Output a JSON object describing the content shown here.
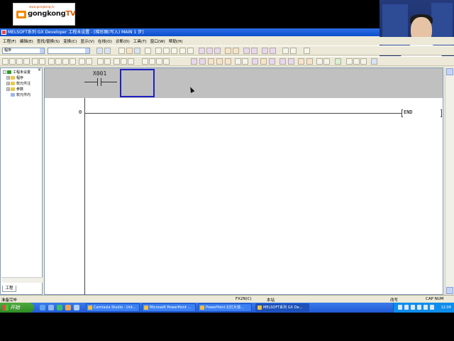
{
  "overlay": {
    "logo_url": "www.gongkong.tv",
    "logo_brand": "gongkong",
    "logo_tv": "TV"
  },
  "window": {
    "title": "MELSOFT系列 GX Developer 工程未设置 - [梯形图(写入)    MAIN    1 步]"
  },
  "menu": [
    "工程(F)",
    "编辑(E)",
    "查找/替换(S)",
    "变换(C)",
    "显示(V)",
    "在线(O)",
    "诊断(D)",
    "工具(T)",
    "窗口(W)",
    "帮助(H)"
  ],
  "toolbar": {
    "data_type_combo": "程序",
    "second_combo": ""
  },
  "tree": {
    "root": "工程未设置",
    "items": [
      "程序",
      "软元件注",
      "参数",
      "软元件内"
    ],
    "tab_label": "工程"
  },
  "ladder": {
    "contact_device": "X001",
    "step_number": "0",
    "end_label": "END"
  },
  "status": {
    "ready": "准备完毕",
    "cpu": "FX2N(C)",
    "mode": "本站",
    "edit": "改写",
    "caps": "CAP  NUM"
  },
  "taskbar": {
    "start_label": "开始",
    "tasks": [
      "Camtasia Studio - Unt...",
      "Microsoft PowerPoint ...",
      "PowerPoint 幻灯片放...",
      "MELSOFT系列 GX De..."
    ],
    "clock": "12:04"
  },
  "colors": {
    "title_blue": "#0a4ccb",
    "selection_box": "#2020c0",
    "input_band": "#c0c0c0",
    "taskbar_blue": "#225ad6"
  }
}
